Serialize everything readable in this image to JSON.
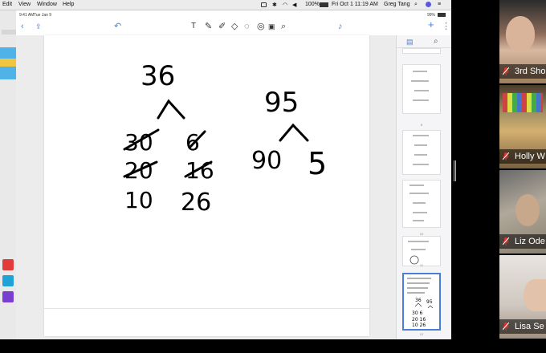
{
  "menu_bar": {
    "items": [
      "Edit",
      "View",
      "Window",
      "Help"
    ],
    "battery": "100%",
    "clock": "Fri Oct 1 11:19 AM",
    "user": "Greg Tang"
  },
  "ipad_status": {
    "time": "9:41 AM",
    "date": "Tue Jan 9",
    "battery": "99%"
  },
  "toolbar": {
    "back_icon": "chevron-left-icon",
    "share_icon": "share-icon",
    "undo_icon": "undo-icon",
    "tools": [
      "text-tool-icon",
      "pen-icon",
      "highlighter-icon",
      "eraser-icon",
      "lasso-icon",
      "shapes-icon",
      "image-icon",
      "search-icon"
    ],
    "mic_icon": "microphone-icon",
    "add": "+",
    "more": "⋮"
  },
  "sidebar": {
    "tabs": [
      "pages-icon",
      "search-icon"
    ],
    "thumb_numbers": [
      "8",
      "9",
      "10",
      "11",
      "12"
    ],
    "page_indicator": "12",
    "page_total": "12"
  },
  "whiteboard": {
    "tree1": {
      "root": "36",
      "left": [
        "30",
        "20",
        "10"
      ],
      "right": [
        "6",
        "16",
        "26"
      ]
    },
    "tree2": {
      "root": "95",
      "left": "90",
      "right": "5"
    }
  },
  "participants": [
    {
      "name": "3rd Sho",
      "muted": true
    },
    {
      "name": "Holly W",
      "muted": true
    },
    {
      "name": "Liz Ode",
      "muted": true
    },
    {
      "name": "Lisa Se",
      "muted": true
    }
  ],
  "colors": {
    "accent": "#4a7fd6",
    "muted_red": "#e0322f"
  }
}
